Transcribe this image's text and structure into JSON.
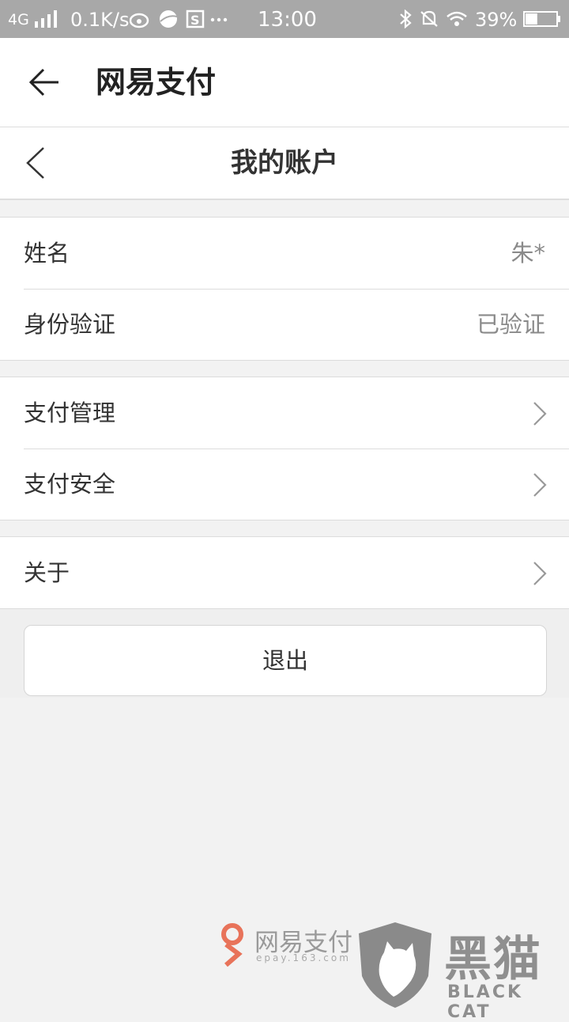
{
  "status_bar": {
    "network": "4G",
    "speed": "0.1K/s",
    "time": "13:00",
    "battery": "39%",
    "battery_level": 0.39,
    "icons": [
      "signal-icon",
      "weibo-icon",
      "browser-icon",
      "s-app-icon",
      "more-icon",
      "bluetooth-icon",
      "mute-icon",
      "wifi-icon",
      "battery-icon"
    ]
  },
  "app_bar": {
    "title": "网易支付"
  },
  "header": {
    "title": "我的账户"
  },
  "groups": [
    [
      {
        "label": "姓名",
        "value": "朱*"
      },
      {
        "label": "身份验证",
        "value": "已验证"
      }
    ],
    [
      {
        "label": "支付管理"
      },
      {
        "label": "支付安全"
      }
    ],
    [
      {
        "label": "关于"
      }
    ]
  ],
  "logout_label": "退出",
  "watermark": {
    "brand": "网易支付",
    "url": "epay.163.com",
    "heimao": "黑猫",
    "blackcat": "BLACK CAT"
  },
  "colors": {
    "status_bar": "#a8a8a8",
    "background": "#f2f2f2",
    "watermark_red": "#e8735a"
  }
}
